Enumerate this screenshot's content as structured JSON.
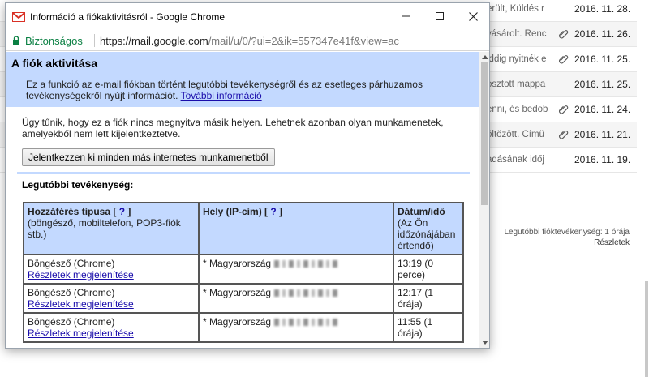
{
  "background": {
    "rows": [
      {
        "snippet": "erült, Küldés r",
        "date": "2016. 11. 28."
      },
      {
        "snippet": "vásárolt. Renc",
        "date": "2016. 11. 26."
      },
      {
        "snippet": "iddig nyitnék e",
        "date": "2016. 11. 25."
      },
      {
        "snippet": "osztott mappa",
        "date": "2016. 11. 25."
      },
      {
        "snippet": "enni, és bedob",
        "date": "2016. 11. 24."
      },
      {
        "snippet": "öltözött. Címü",
        "date": "2016. 11. 21."
      },
      {
        "snippet": "adásának időj",
        "date": "2016. 11. 19."
      }
    ],
    "activity_text": "Legutóbbi fióktevékenység: 1 órája",
    "details_link": "Részletek"
  },
  "window": {
    "title": "Információ a fiókaktivitásról - Google Chrome",
    "secure_label": "Biztonságos",
    "url_host": "https://mail.google.com",
    "url_path": "/mail/u/0/?ui=2&ik=557347e41f&view=ac"
  },
  "info": {
    "title": "A fiók aktivitása",
    "description": "Ez a funkció az e-mail fiókban történt legutóbbi tevékenységről és az esetleges párhuzamos tevékenységekről nyújt információt.",
    "more_link": "További információ"
  },
  "status": {
    "text": "Úgy tűnik, hogy ez a fiók nincs megnyitva másik helyen. Lehetnek azonban olyan munkamenetek, amelyekből nem lett kijelentkeztetve.",
    "signout_button": "Jelentkezzen ki minden más internetes munkamenetből"
  },
  "recent": {
    "title": "Legutóbbi tevékenység:",
    "headers": {
      "access_type": "Hozzáférés típusa",
      "access_type_help": "?",
      "access_type_sub": "(böngésző, mobiltelefon, POP3-fiók stb.)",
      "location": "Hely (IP-cím)",
      "location_help": "?",
      "datetime": "Dátum/idő",
      "datetime_sub": "(Az Ön időzónájában értendő)"
    },
    "rows": [
      {
        "type": "Böngésző (Chrome)",
        "details": "Részletek megjelenítése",
        "location": "* Magyarország",
        "time": "13:19 (0 perce)"
      },
      {
        "type": "Böngésző (Chrome)",
        "details": "Részletek megjelenítése",
        "location": "* Magyarország",
        "time": "12:17 (1 órája)"
      },
      {
        "type": "Böngésző (Chrome)",
        "details": "Részletek megjelenítése",
        "location": "* Magyarország",
        "time": "11:55 (1 órája)"
      }
    ]
  },
  "colors": {
    "info_bg": "#c3d9ff",
    "secure_green": "#0b8043",
    "link_blue": "#1a0dab",
    "gmail_red": "#d93025"
  }
}
